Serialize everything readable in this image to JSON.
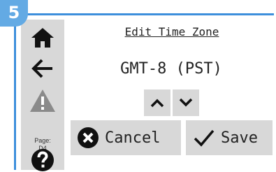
{
  "step": {
    "number": "5"
  },
  "sidebar": {
    "home_icon": "home-icon",
    "back_icon": "arrow-left-icon",
    "warning_icon": "warning-icon",
    "page_label": "Page:",
    "page_id": "D4",
    "help_icon": "question-icon"
  },
  "main": {
    "title": "Edit Time Zone",
    "value": "GMT-8 (PST)",
    "up_icon": "chevron-up-icon",
    "down_icon": "chevron-down-icon",
    "cancel_label": "Cancel",
    "save_label": "Save"
  },
  "colors": {
    "accent": "#3d8fdc",
    "badge": "#63aae4",
    "button_bg": "#d8d8d8",
    "icon_dark": "#111111",
    "icon_muted": "#8a8a8a"
  }
}
